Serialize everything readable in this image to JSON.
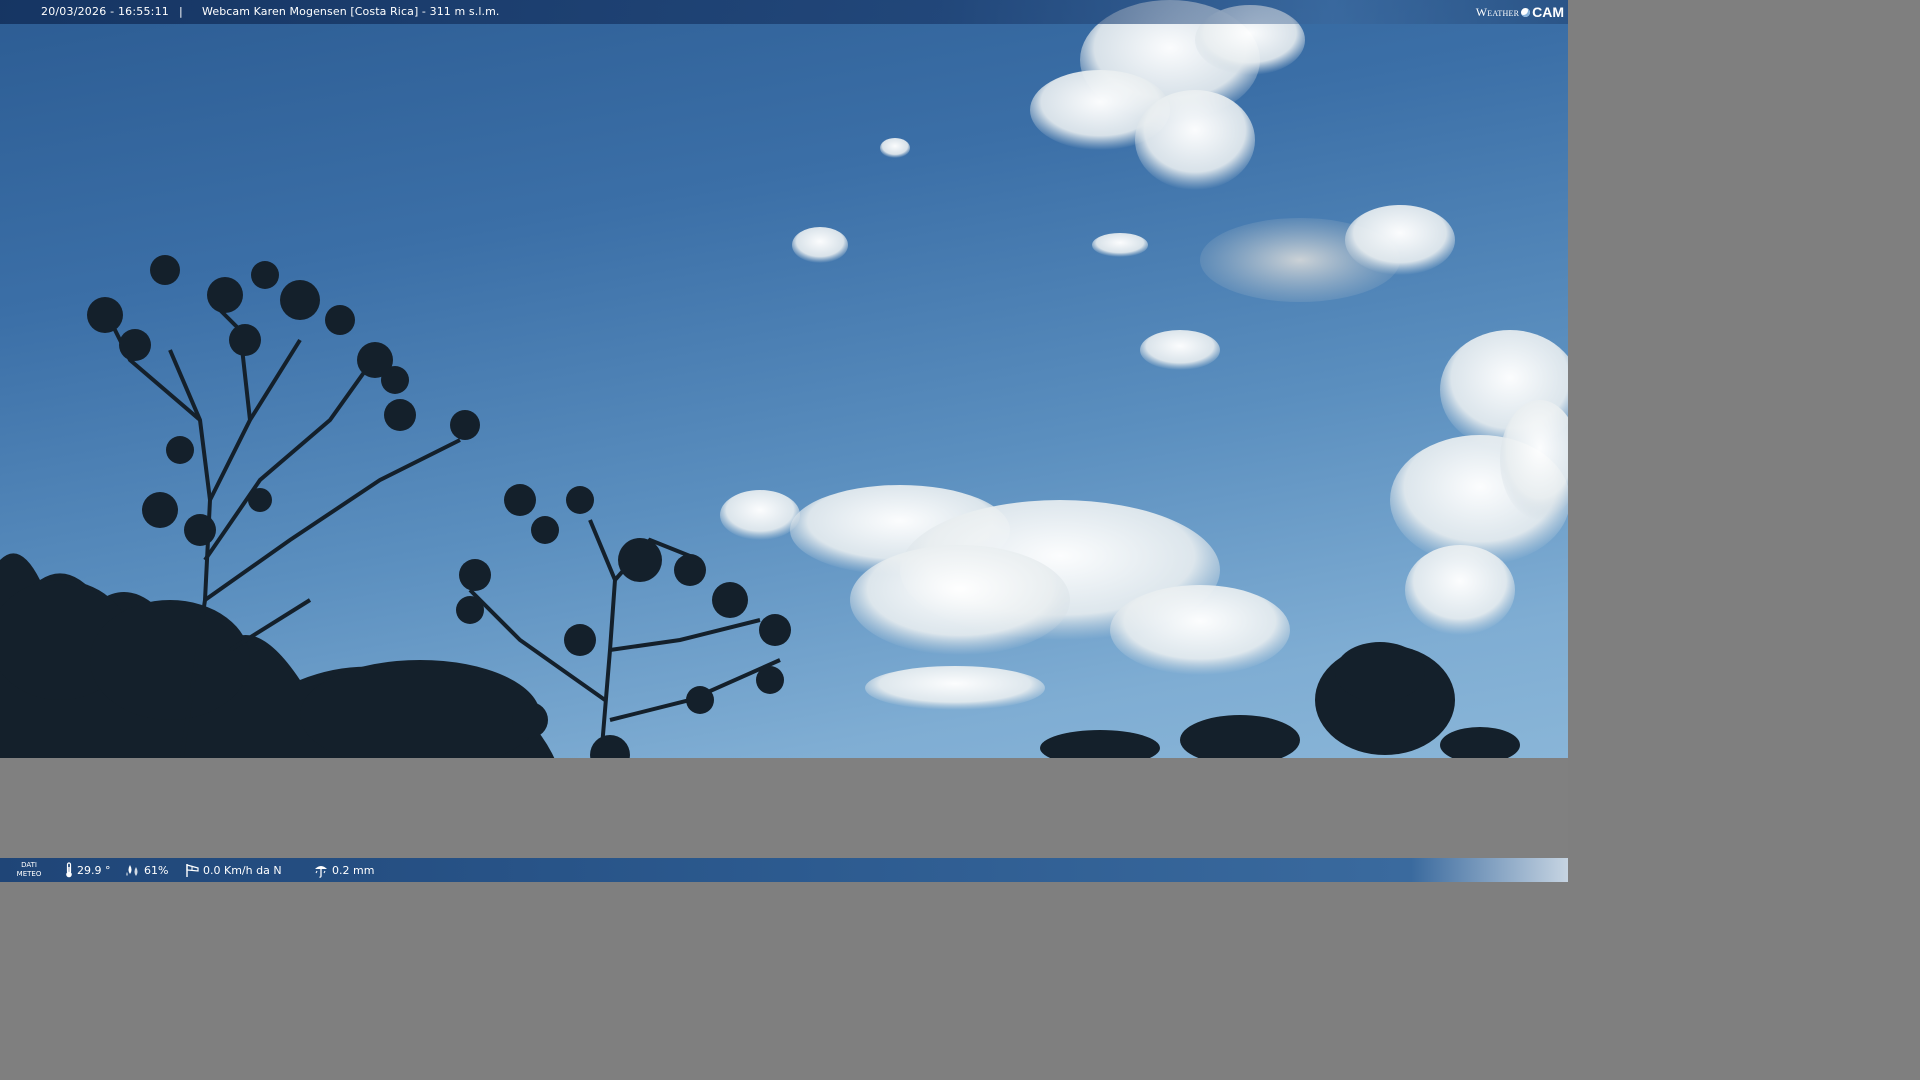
{
  "top_bar": {
    "datetime": "20/03/2026 - 16:55:11",
    "separator": "|",
    "title": "Webcam Karen Mogensen [Costa Rica]  - 311 m s.l.m."
  },
  "brand": {
    "weather": "Weather",
    "cam": "CAM"
  },
  "bottom_bar": {
    "label_line1": "DATI",
    "label_line2": "METEO",
    "temperature": "29.9 °",
    "humidity": "61%",
    "wind": "0.0 Km/h da N",
    "rain": "0.2 mm"
  },
  "icons": {
    "temperature": "thermometer-icon",
    "humidity": "humidity-drops-icon",
    "wind": "wind-sock-icon",
    "rain": "rain-gauge-icon"
  }
}
